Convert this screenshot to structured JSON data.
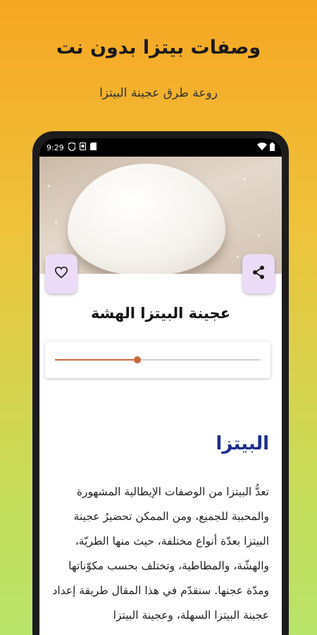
{
  "promo": {
    "title": "وصفات بيتزا بدون نت",
    "subtitle": "روعة طرق عجينة البيتزا"
  },
  "status_bar": {
    "time": "9:29",
    "icons": [
      "shield-icon",
      "notification-icon",
      "sim-icon",
      "wifi-icon",
      "battery-icon"
    ]
  },
  "recipe": {
    "title": "عجينة البيتزا الهشة",
    "image": "pizza-dough-ball",
    "audio_progress_percent": 40
  },
  "article": {
    "heading": "البيتزا",
    "body": "تعدُّ البيتزا من الوصفات الإيطالية المشهورة والمحببة للجميع، ومن الممكن تحضيرُ عجينة البيتزا بعدّة أنواع مختلفة، حيث منها الطريّة، والهشّة، والمطاطية، وتختلف بحسب مكوّناتها ومدّة عجنها. سنقدّم في هذا المقال طريقة إعداد عجينة البيتزا السهلة، وعجينة البيتزا"
  },
  "colors": {
    "accent": "#c8693a",
    "fab_background": "#ecdcf7",
    "heading": "#1c2f8c"
  }
}
